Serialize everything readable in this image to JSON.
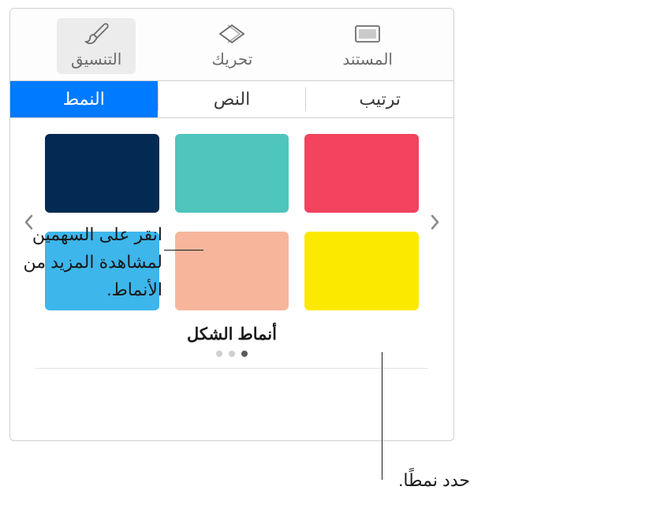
{
  "toolbar": {
    "format": {
      "label": "التنسيق"
    },
    "animate": {
      "label": "تحريك"
    },
    "document": {
      "label": "المستند"
    }
  },
  "tabs": {
    "style": "النمط",
    "text": "النص",
    "arrange": "ترتيب"
  },
  "shapeStylesLabel": "أنماط الشكل",
  "styles": [
    {
      "color": "#f2435f"
    },
    {
      "color": "#4ec5bd"
    },
    {
      "color": "#032a52"
    },
    {
      "color": "#fbe900"
    },
    {
      "color": "#f7b69c"
    },
    {
      "color": "#3db6ec"
    }
  ],
  "callouts": {
    "arrows": "انقر على السهمين لمشاهدة المزيد من الأنماط.",
    "select": "حدد نمطًا."
  }
}
